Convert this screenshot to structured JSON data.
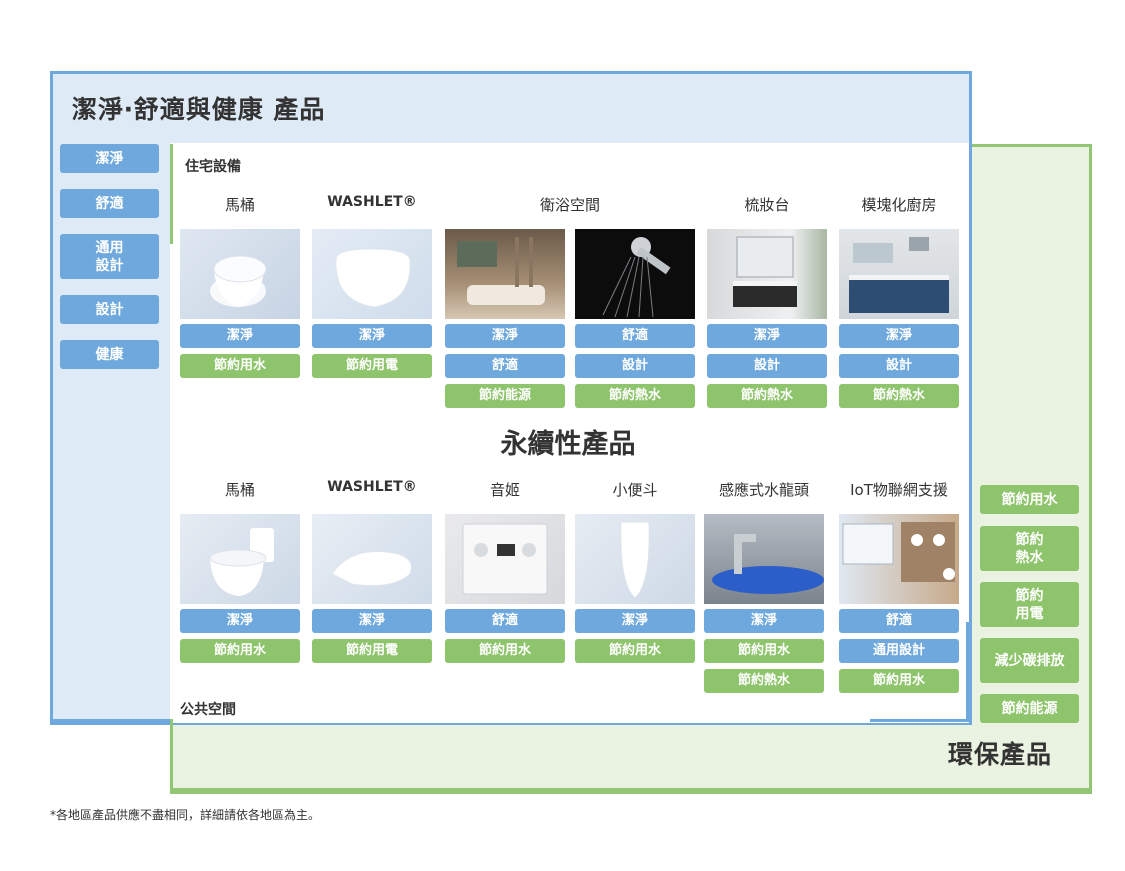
{
  "title_main": "潔淨‧舒適與健康 產品",
  "title_sustain": "永續性產品",
  "title_green": "環保產品",
  "label_home": "住宅設備",
  "label_public": "公共空間",
  "footnote": "*各地區產品供應不盡相同，詳細請依各地區為主。",
  "left_tags": [
    "潔淨",
    "舒適",
    "通用\n設計",
    "設計",
    "健康"
  ],
  "right_tags": [
    "節約用水",
    "節約\n熱水",
    "節約\n用電",
    "減少碳排放",
    "節約能源"
  ],
  "home_headers": [
    "馬桶",
    "WASHLET®",
    "衛浴空間",
    "梳妝台",
    "模塊化廚房"
  ],
  "public_headers": [
    "馬桶",
    "WASHLET®",
    "音姬",
    "小便斗",
    "感應式水龍頭",
    "IoT物聯網支援"
  ],
  "home_tags": [
    [
      "潔淨",
      "節約用水"
    ],
    [
      "潔淨",
      "節約用電"
    ],
    [
      "潔淨",
      "舒適",
      "節約能源"
    ],
    [
      "舒適",
      "設計",
      "節約熱水"
    ],
    [
      "潔淨",
      "設計",
      "節約熱水"
    ],
    [
      "潔淨",
      "設計",
      "節約熱水"
    ]
  ],
  "public_tags": [
    [
      "潔淨",
      "節約用水"
    ],
    [
      "潔淨",
      "節約用電"
    ],
    [
      "舒適",
      "節約用水"
    ],
    [
      "潔淨",
      "節約用水"
    ],
    [
      "潔淨",
      "節約用水",
      "節約熱水"
    ],
    [
      "舒適",
      "通用設計",
      "節約用水"
    ]
  ],
  "colors": {
    "blue": "#6ea8dc",
    "green": "#8ec46b",
    "blue_bg": "#deeaf6",
    "green_bg": "#eaf3e1"
  }
}
